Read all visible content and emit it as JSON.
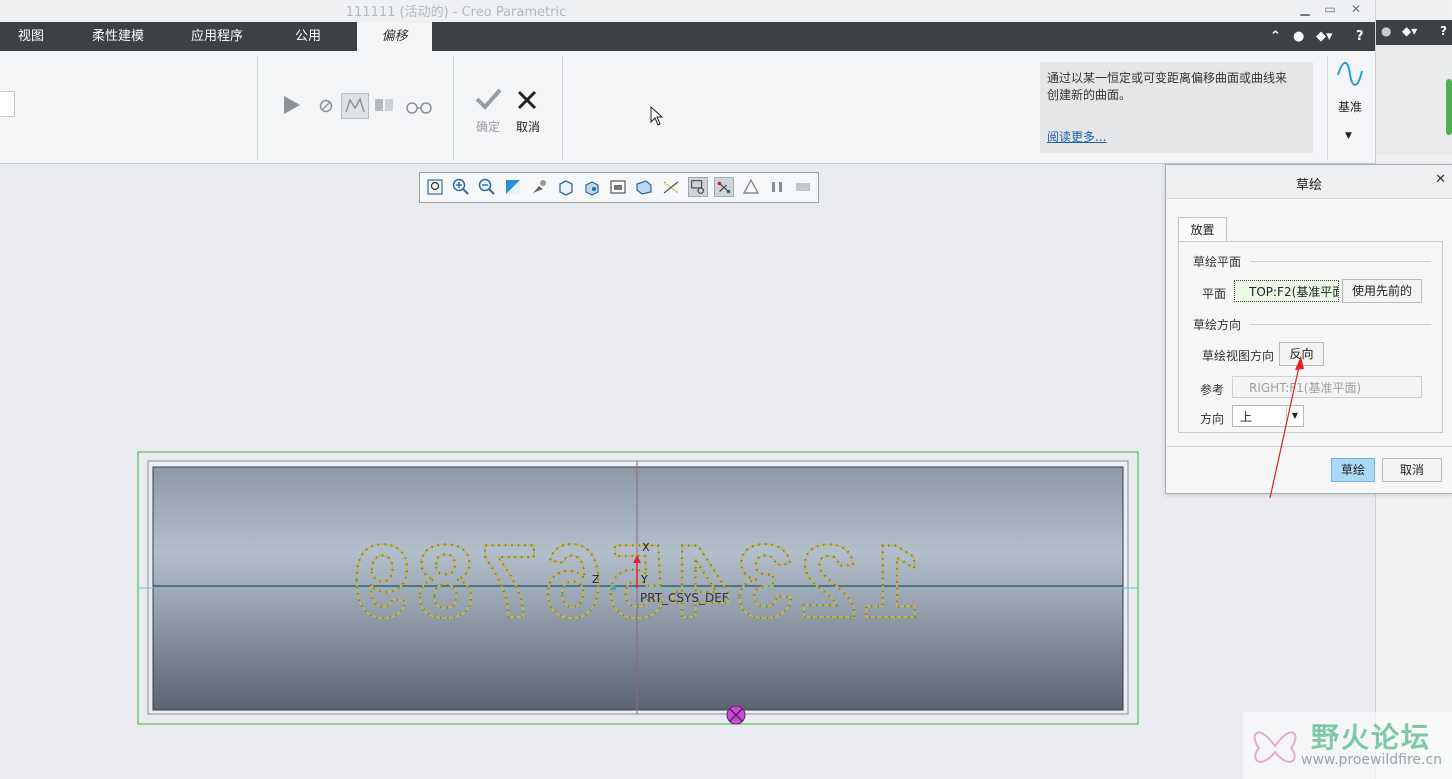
{
  "window": {
    "title": "111111 (活动的) - Creo Parametric",
    "controls": [
      "minimize-icon",
      "maximize-icon",
      "close-icon"
    ]
  },
  "menu": {
    "tabs": [
      "视图",
      "柔性建模",
      "应用程序",
      "公用",
      "偏移"
    ],
    "active_tab": "偏移",
    "right_icons": [
      "chevron-up-icon",
      "light-bulb-icon",
      "graduation-cap-icon",
      "help-icon"
    ],
    "help_label": "?"
  },
  "ribbon": {
    "ok_label": "确定",
    "cancel_label": "取消",
    "help_text": "通过以某一恒定或可变距离偏移曲面或曲线来创建新的曲面。",
    "read_more": "阅读更多...",
    "datum_label": "基准"
  },
  "model": {
    "engraved_text": "123456789",
    "csys_label": "PRT_CSYS_DEF",
    "axis_x": "X",
    "axis_y": "Y",
    "axis_z": "Z"
  },
  "dialog": {
    "title": "草绘",
    "tab": "放置",
    "section_plane": "草绘平面",
    "plane_label": "平面",
    "plane_value": "TOP:F2(基准平面",
    "use_previous": "使用先前的",
    "section_orientation": "草绘方向",
    "view_direction_label": "草绘视图方向",
    "flip_button": "反向",
    "reference_label": "参考",
    "reference_value": "RIGHT:F1(基准平面)",
    "direction_label": "方向",
    "direction_value": "上",
    "sketch_button": "草绘",
    "cancel_button": "取消"
  },
  "watermark": {
    "name": "野火论坛",
    "url": "www.proewildfire.cn"
  },
  "colors": {
    "menubar": "#3b4144",
    "ribbon": "#f4f5f6",
    "sketch_outline": "#e0a84a",
    "selection_green": "#3cb043",
    "primary_button": "#a9d9f5",
    "annotation_arrow": "#e02020"
  }
}
